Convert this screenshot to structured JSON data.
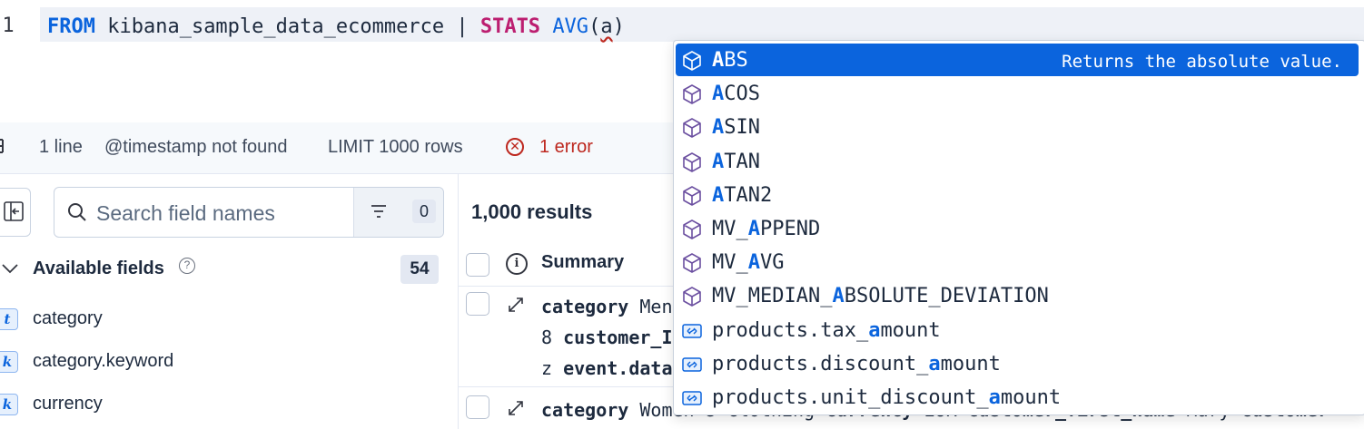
{
  "editor": {
    "line_number": "1",
    "tokens": {
      "from": "FROM",
      "index": " kibana_sample_data_ecommerce | ",
      "stats": "STATS",
      "space": " ",
      "func": "AVG",
      "open": "(",
      "arg": "a",
      "close": ")"
    }
  },
  "status": {
    "lines": "1 line",
    "timestamp": "@timestamp not found",
    "limit": "LIMIT 1000 rows",
    "error_icon": "error-circle-icon",
    "errors": "1 error",
    "error_color": "#bd271e"
  },
  "sidebar": {
    "search_placeholder": "Search field names",
    "filter_count": "0",
    "available_title": "Available fields",
    "available_count": "54",
    "fields": [
      {
        "type": "t",
        "name": "category"
      },
      {
        "type": "k",
        "name": "category.keyword"
      },
      {
        "type": "k",
        "name": "currency"
      }
    ]
  },
  "results": {
    "count": "1,000 results",
    "summary_header": "Summary",
    "row1_line1_key": "category",
    "row1_line1_val": " Men",
    "row1_line2_pre": "8 ",
    "row1_line2_key": "customer_I",
    "row1_line3_pre": "z ",
    "row1_line3_key": "event.data",
    "row2_key": "category",
    "row2_val": " Women's Clothing ",
    "row2_key2": "currency",
    "row2_val2": " EUR ",
    "row2_key3": "customer_first_name",
    "row2_val3": " Mary ",
    "row2_key4": "customer"
  },
  "autocomplete": {
    "accent": "#0b64dd",
    "items": [
      {
        "pre": "",
        "match": "A",
        "post": "BS",
        "icon": "function-cube-icon",
        "detail": "Returns the absolute value."
      },
      {
        "pre": "",
        "match": "A",
        "post": "COS",
        "icon": "function-cube-icon"
      },
      {
        "pre": "",
        "match": "A",
        "post": "SIN",
        "icon": "function-cube-icon"
      },
      {
        "pre": "",
        "match": "A",
        "post": "TAN",
        "icon": "function-cube-icon"
      },
      {
        "pre": "",
        "match": "A",
        "post": "TAN2",
        "icon": "function-cube-icon"
      },
      {
        "pre": "MV_",
        "match": "A",
        "post": "PPEND",
        "icon": "function-cube-icon"
      },
      {
        "pre": "MV_",
        "match": "A",
        "post": "VG",
        "icon": "function-cube-icon"
      },
      {
        "pre": "MV_MEDIAN_",
        "match": "A",
        "post": "BSOLUTE_DEVIATION",
        "icon": "function-cube-icon"
      },
      {
        "pre": "products.tax_",
        "match": "a",
        "post": "mount",
        "icon": "field-icon"
      },
      {
        "pre": "products.discount_",
        "match": "a",
        "post": "mount",
        "icon": "field-icon"
      },
      {
        "pre": "products.unit_discount_",
        "match": "a",
        "post": "mount",
        "icon": "field-icon"
      }
    ]
  }
}
